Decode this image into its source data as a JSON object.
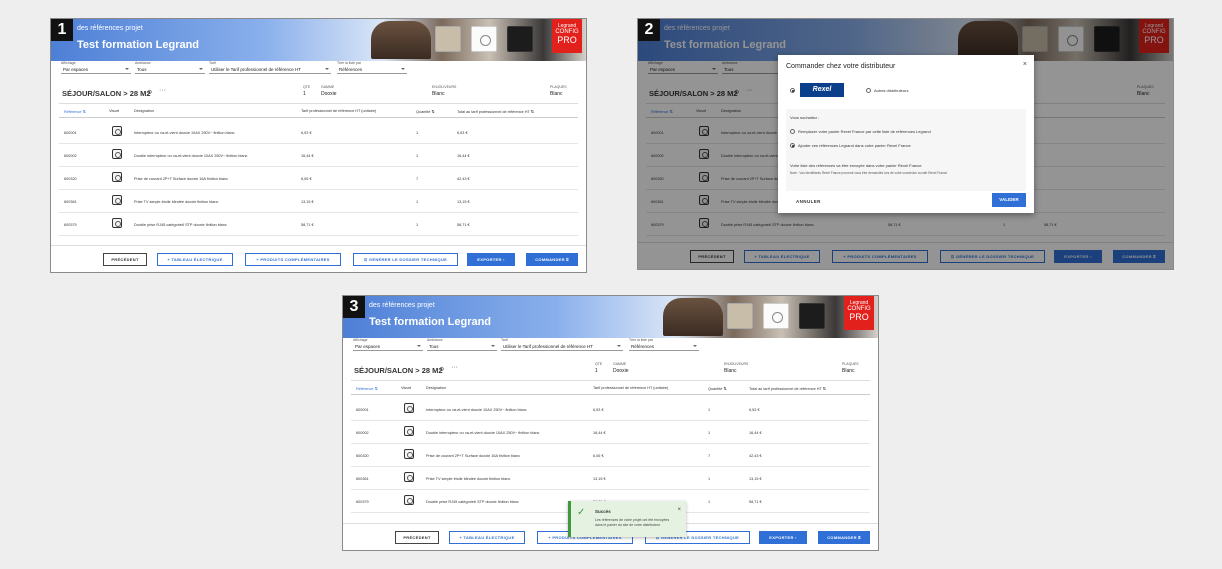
{
  "badges": [
    "1",
    "2",
    "3"
  ],
  "banner": {
    "subtitle": "des références projet",
    "title": "Test formation Legrand",
    "logo_line1": "Legrand",
    "logo_line2": "CONFIG",
    "logo_line3": "PRO"
  },
  "filters": [
    {
      "label": "Affichage",
      "value": "Par espaces"
    },
    {
      "label": "Ambiance",
      "value": "Tous"
    },
    {
      "label": "Tarif",
      "value": "Utiliser le Tarif professionnel de référence HT"
    },
    {
      "label": "Trier la liste par",
      "value": "Références"
    }
  ],
  "section": {
    "title": "SÉJOUR/SALON > 28 M2",
    "gear": "⚙",
    "dots": "···",
    "qty_label": "QTE",
    "qty_value": "1",
    "range_label": "GAMME",
    "range_value": "Dooxie",
    "enclosure_label": "ENJOLIVEURS",
    "enclosure_value": "Blanc",
    "plates_label": "PLAQUES",
    "plates_value": "Blanc"
  },
  "table": {
    "headers": {
      "reference": "Référence ⇅",
      "visual": "Visuel",
      "designation": "Désignation",
      "unit_price": "Tarif professionnel de référence HT (unitaire)",
      "quantity": "Quantité ⇅",
      "total": "Total au tarif professionnel de référence HT ⇅"
    },
    "rows": [
      {
        "ref": "600001",
        "des": "Interrupteur ou va-et-vient dooxie 10AX 250V~ finition blanc",
        "pu": "6,53 €",
        "qty": "1",
        "tot": "6,53 €"
      },
      {
        "ref": "600002",
        "des": "Double interrupteur ou va-et-vient dooxie 10AX 250V~ finition blanc",
        "pu": "16,44 €",
        "qty": "1",
        "tot": "16,44 €"
      },
      {
        "ref": "600320",
        "des": "Prise de courant 2P+T Surface dooxie 16A finition blanc",
        "pu": "6,06 €",
        "qty": "7",
        "tot": "42,43 €"
      },
      {
        "ref": "600361",
        "des": "Prise TV simple étoile blindée dooxie finition blanc",
        "pu": "13,15 €",
        "qty": "1",
        "tot": "13,15 €"
      },
      {
        "ref": "600379",
        "des": "Double prise RJ45 catégorie6 STP dooxie finition blanc",
        "pu": "58,71 €",
        "qty": "1",
        "tot": "58,71 €"
      }
    ]
  },
  "footer": {
    "previous": "PRÉCÉDENT",
    "electrical": "+ TABLEAU ÉLECTRIQUE",
    "complementary": "+ PRODUITS COMPLÉMENTAIRES",
    "technical": "⊡ GÉNÉRER LE DOSSIER TECHNIQUE",
    "export": "EXPORTER ›",
    "order": "COMMANDER ⌗"
  },
  "modal": {
    "title": "Commander chez votre distributeur",
    "close": "×",
    "rexel_logo": "Rexel",
    "other": "Autres distributeurs",
    "question": "Vous souhaitez :",
    "option1": "Remplacer votre panier Rexel France par cette liste de références Legrand",
    "option2": "Ajouter ces références Legrand dans votre panier Rexel France",
    "info": "Votre liste des références va être envoyée dans votre panier Rexel France",
    "note": "Note : Vos identifiants Rexel France pourront vous être demandés lors de votre connexion au site Rexel France",
    "cancel": "ANNULER",
    "validate": "VALIDER"
  },
  "toast": {
    "check": "✓",
    "title": "Succès",
    "message": "Les références de votre projet ont été envoyées dans le panier du site de votre distributeur",
    "close": "×"
  }
}
